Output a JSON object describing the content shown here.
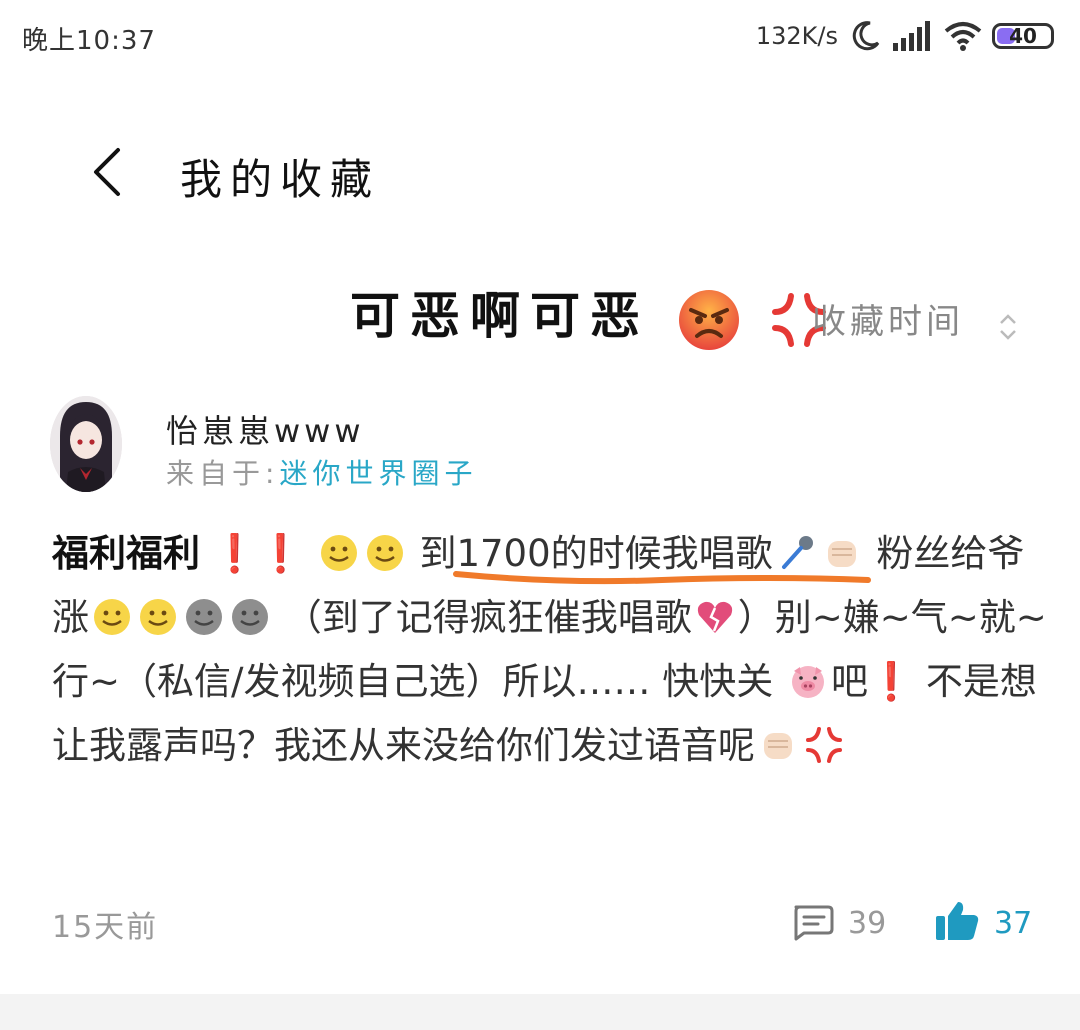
{
  "status_bar": {
    "time": "晚上10:37",
    "net_speed": "132K/s",
    "battery": "40",
    "battery_level": 0.4,
    "icons": [
      "moon-icon",
      "signal-icon",
      "wifi-icon",
      "battery-icon"
    ]
  },
  "header": {
    "title": "我的收藏",
    "back_icon": "chevron-left-icon"
  },
  "sort": {
    "heading": "可恶啊可恶",
    "label": "收藏时间",
    "icon": "sort-chevron-icon"
  },
  "post": {
    "author": "怡崽崽www",
    "source_prefix": "来自于:",
    "source_group": "迷你世界圈子",
    "content": {
      "bold": "福利福利",
      "highlight": "到1700的时候我唱歌",
      "p1": "粉丝给爷涨",
      "p2": "（到了记得疯狂催我唱歌",
      "p3": "）别~嫌~气~就~行~（私信/发视频自己选）所以…… 快快关",
      "p4": "吧",
      "p5": " 不是想让我露声吗？我还从来没给你们发过语音呢"
    },
    "time": "15天前",
    "comments": "39",
    "likes": "37"
  },
  "colors": {
    "accent": "#1f9ac0",
    "link": "#29a7c7",
    "underline": "#f07a2a",
    "battery_fill": "#8a6df2"
  }
}
